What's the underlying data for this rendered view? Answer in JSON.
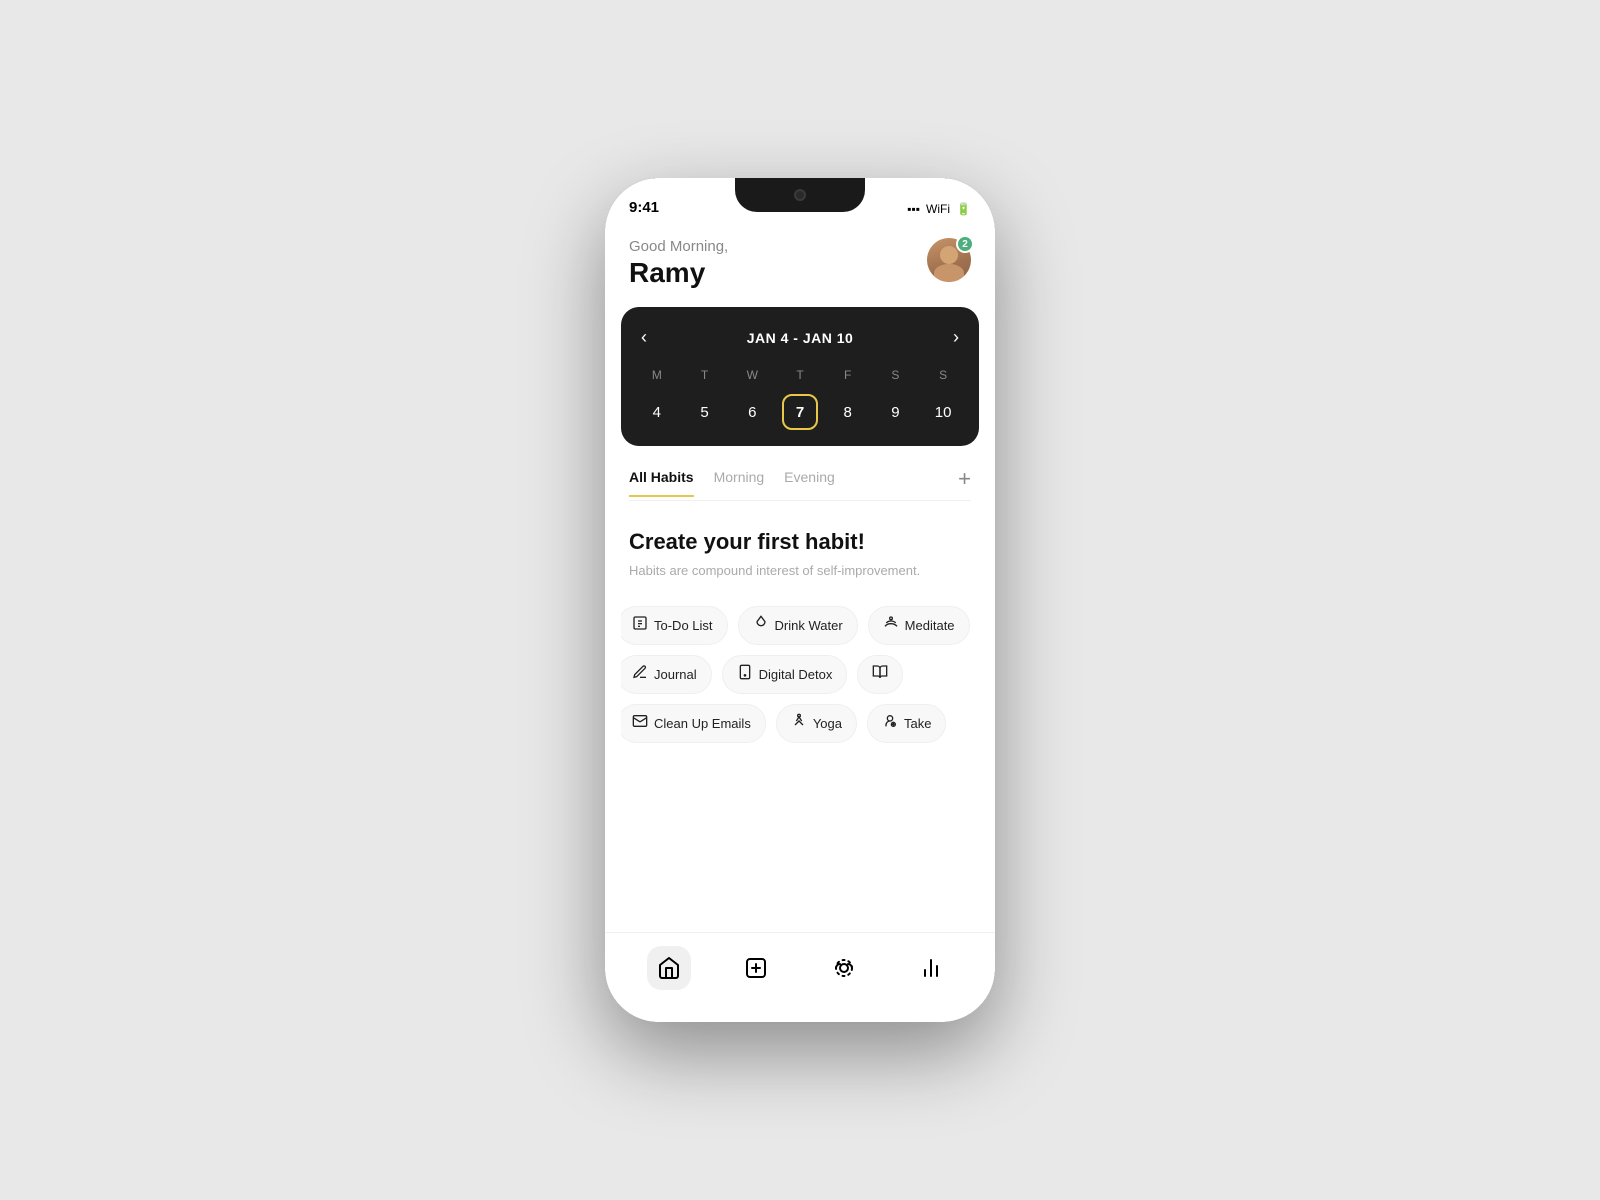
{
  "phone": {
    "greeting": "Good Morning,",
    "username": "Ramy",
    "badge_count": "2",
    "calendar": {
      "title": "JAN 4 - JAN 10",
      "days": [
        "M",
        "T",
        "W",
        "T",
        "F",
        "S",
        "S"
      ],
      "dates": [
        "4",
        "5",
        "6",
        "7",
        "8",
        "9",
        "10"
      ],
      "today_index": 3
    },
    "tabs": [
      {
        "label": "All Habits",
        "active": true
      },
      {
        "label": "Morning",
        "active": false
      },
      {
        "label": "Evening",
        "active": false
      }
    ],
    "add_button": "+",
    "empty_state": {
      "title": "Create your first habit!",
      "subtitle": "Habits are compound interest of self-improvement."
    },
    "habit_chips": {
      "row1": [
        {
          "icon": "📝",
          "label": "To-Do List"
        },
        {
          "icon": "💧",
          "label": "Drink Water"
        },
        {
          "icon": "🧘",
          "label": "Meditate"
        }
      ],
      "row2": [
        {
          "icon": "✏️",
          "label": "Journal"
        },
        {
          "icon": "📱",
          "label": "Digital Detox"
        },
        {
          "icon": "📖",
          "label": ""
        }
      ],
      "row3": [
        {
          "icon": "✉️",
          "label": "Clean Up Emails"
        },
        {
          "icon": "🏃",
          "label": "Yoga"
        },
        {
          "icon": "👤",
          "label": "Take"
        }
      ]
    },
    "nav": [
      {
        "icon": "home",
        "active": true
      },
      {
        "icon": "plus",
        "active": false
      },
      {
        "icon": "camera",
        "active": false
      },
      {
        "icon": "chart",
        "active": false
      }
    ]
  }
}
